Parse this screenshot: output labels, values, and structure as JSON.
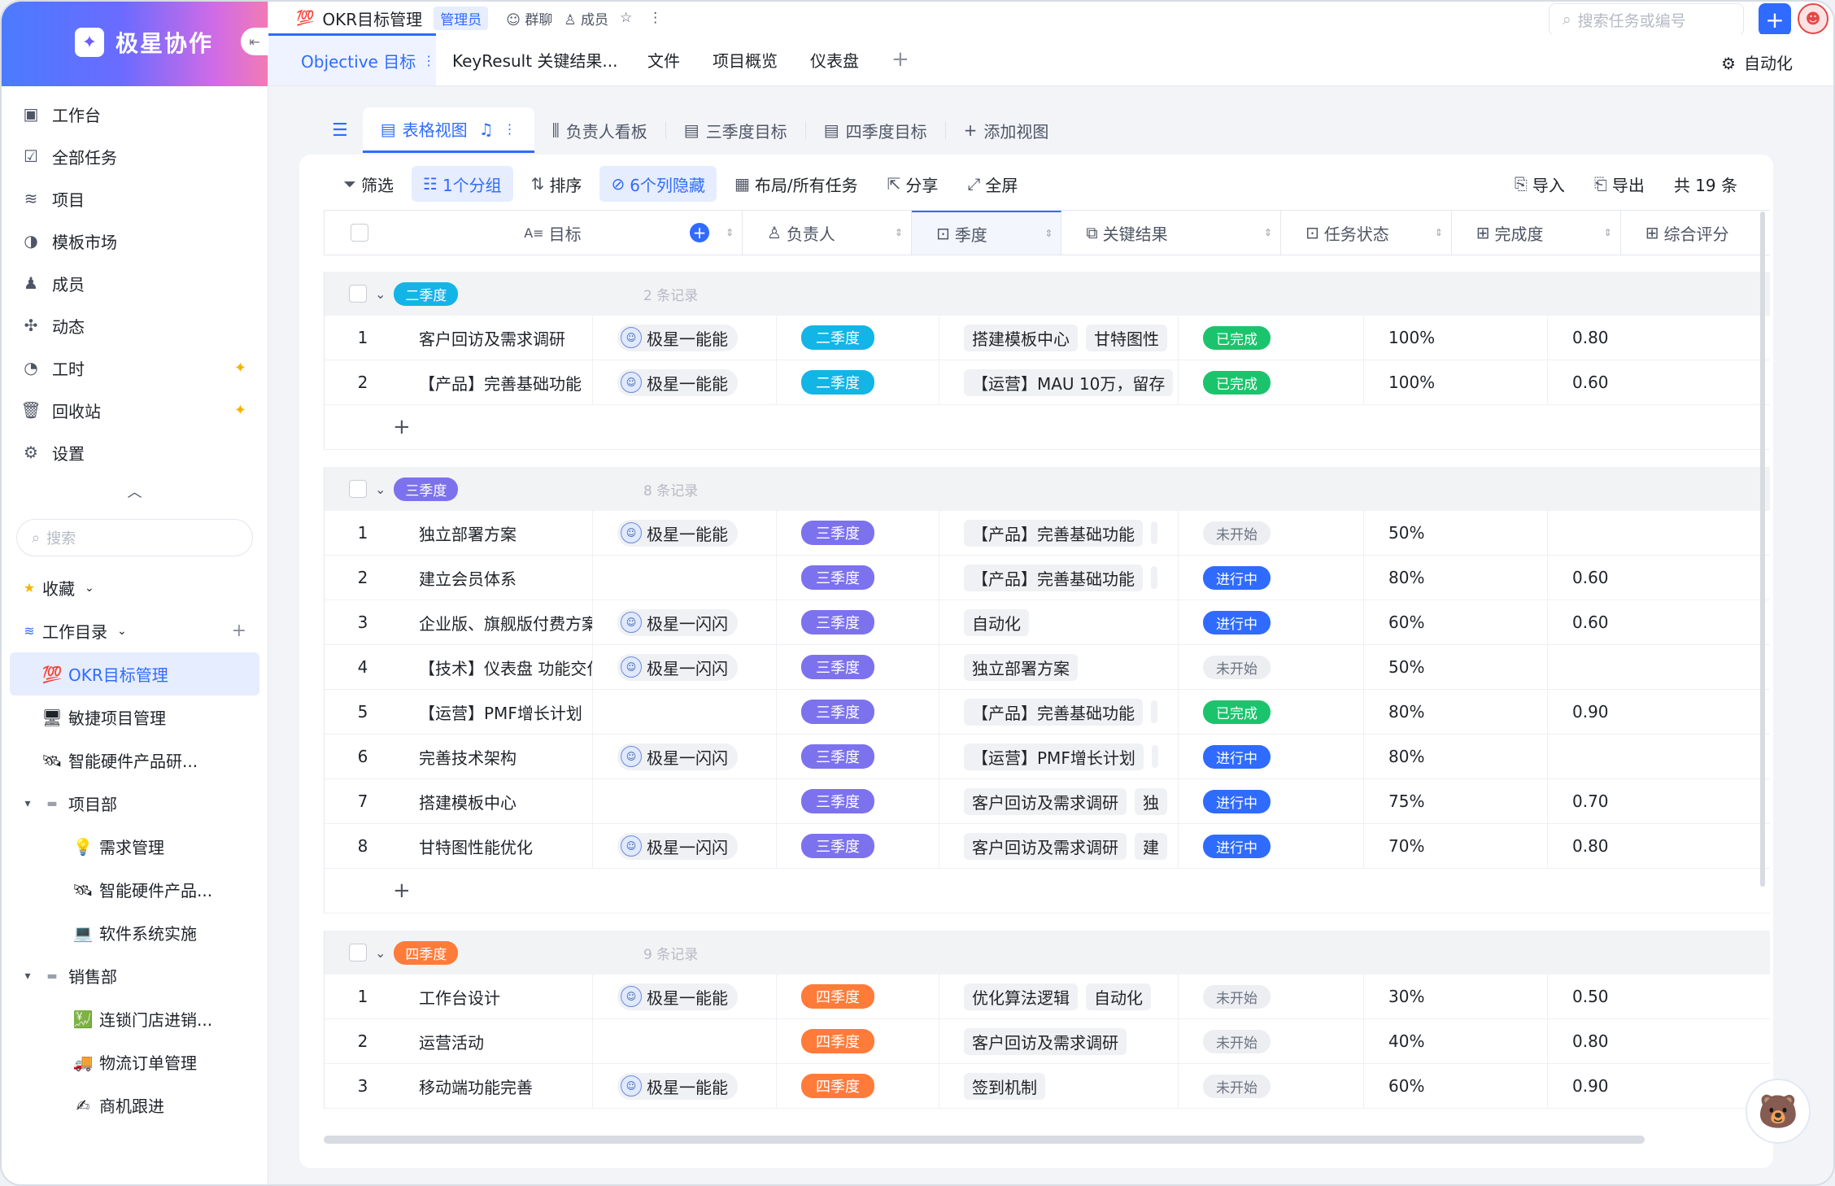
{
  "app": {
    "name": "极星协作"
  },
  "nav": [
    {
      "label": "工作台",
      "icon": "workbench-icon"
    },
    {
      "label": "全部任务",
      "icon": "tasks-icon"
    },
    {
      "label": "项目",
      "icon": "project-icon"
    },
    {
      "label": "模板市场",
      "icon": "template-icon"
    },
    {
      "label": "成员",
      "icon": "member-icon"
    },
    {
      "label": "动态",
      "icon": "activity-icon"
    },
    {
      "label": "工时",
      "icon": "clock-icon"
    },
    {
      "label": "回收站",
      "icon": "trash-icon"
    },
    {
      "label": "设置",
      "icon": "settings-icon"
    }
  ],
  "sidebar": {
    "search_placeholder": "搜索",
    "favorites": "收藏",
    "workdir": "工作目录",
    "tree": [
      {
        "label": "OKR目标管理",
        "emoji": "💯",
        "indent": 1,
        "active": true
      },
      {
        "label": "敏捷项目管理",
        "emoji": "🖥",
        "indent": 1
      },
      {
        "label": "智能硬件产品研...",
        "emoji": "🛰",
        "indent": 1
      },
      {
        "label": "项目部",
        "emoji": "▬",
        "indent": 0,
        "folder": true
      },
      {
        "label": "需求管理",
        "emoji": "💡",
        "indent": 2
      },
      {
        "label": "智能硬件产品...",
        "emoji": "🛰",
        "indent": 2
      },
      {
        "label": "软件系统实施",
        "emoji": "💻",
        "indent": 2
      },
      {
        "label": "销售部",
        "emoji": "▬",
        "indent": 0,
        "folder": true
      },
      {
        "label": "连锁门店进销...",
        "emoji": "💹",
        "indent": 2
      },
      {
        "label": "物流订单管理",
        "emoji": "🚚",
        "indent": 2
      },
      {
        "label": "商机跟进",
        "emoji": "✍",
        "indent": 2
      }
    ]
  },
  "topbar": {
    "title": "OKR目标管理",
    "title_emoji": "💯",
    "admin_badge": "管理员",
    "links": [
      "群聊",
      "成员"
    ],
    "search_placeholder": "搜索任务或编号"
  },
  "tabs": [
    "Objective 目标",
    "KeyResult 关键结果...",
    "文件",
    "项目概览",
    "仪表盘"
  ],
  "automation": "自动化",
  "views": [
    "表格视图",
    "负责人看板",
    "三季度目标",
    "四季度目标",
    "添加视图"
  ],
  "toolbar": {
    "filter": "筛选",
    "group": "1个分组",
    "sort": "排序",
    "hidden": "6个列隐藏",
    "layout": "布局/所有任务",
    "share": "分享",
    "fullscreen": "全屏",
    "import": "导入",
    "export": "导出",
    "total": "共 19 条"
  },
  "columns": [
    "目标",
    "负责人",
    "季度",
    "关键结果",
    "任务状态",
    "完成度",
    "综合评分"
  ],
  "colors": {
    "primary": "#2f6bff",
    "q2": "#13b5e6",
    "q3": "#7d72ee",
    "q4": "#ff7b3a",
    "done": "#1bc46c",
    "doing": "#2f6bff",
    "todo": "#eceef1"
  },
  "groups": [
    {
      "tag": "二季度",
      "count": "2 条记录",
      "rows": [
        {
          "n": "1",
          "goal": "客户回访及需求调研",
          "owner": "极星一能能",
          "q": "二季度",
          "krs": [
            "搭建模板中心",
            "甘特图性"
          ],
          "status": "已完成",
          "pct": "100%",
          "score": "0.80"
        },
        {
          "n": "2",
          "goal": "【产品】完善基础功能",
          "owner": "极星一能能",
          "q": "二季度",
          "krs": [
            "【运营】MAU 10万，留存"
          ],
          "status": "已完成",
          "pct": "100%",
          "score": "0.60"
        }
      ]
    },
    {
      "tag": "三季度",
      "count": "8 条记录",
      "rows": [
        {
          "n": "1",
          "goal": "独立部署方案",
          "owner": "极星一能能",
          "q": "三季度",
          "krs": [
            "【产品】完善基础功能",
            ""
          ],
          "status": "未开始",
          "pct": "50%",
          "score": ""
        },
        {
          "n": "2",
          "goal": "建立会员体系",
          "owner": "",
          "q": "三季度",
          "krs": [
            "【产品】完善基础功能",
            ""
          ],
          "status": "进行中",
          "pct": "80%",
          "score": "0.60"
        },
        {
          "n": "3",
          "goal": "企业版、旗舰版付费方案",
          "owner": "极星一闪闪",
          "q": "三季度",
          "krs": [
            "自动化"
          ],
          "status": "进行中",
          "pct": "60%",
          "score": "0.60"
        },
        {
          "n": "4",
          "goal": "【技术】仪表盘 功能交付",
          "owner": "极星一闪闪",
          "q": "三季度",
          "krs": [
            "独立部署方案"
          ],
          "status": "未开始",
          "pct": "50%",
          "score": ""
        },
        {
          "n": "5",
          "goal": "【运营】PMF增长计划",
          "owner": "",
          "q": "三季度",
          "krs": [
            "【产品】完善基础功能",
            ""
          ],
          "status": "已完成",
          "pct": "80%",
          "score": "0.90"
        },
        {
          "n": "6",
          "goal": "完善技术架构",
          "owner": "极星一闪闪",
          "q": "三季度",
          "krs": [
            "【运营】PMF增长计划",
            ""
          ],
          "status": "进行中",
          "pct": "80%",
          "score": ""
        },
        {
          "n": "7",
          "goal": "搭建模板中心",
          "owner": "",
          "q": "三季度",
          "krs": [
            "客户回访及需求调研",
            "独"
          ],
          "status": "进行中",
          "pct": "75%",
          "score": "0.70"
        },
        {
          "n": "8",
          "goal": "甘特图性能优化",
          "owner": "极星一闪闪",
          "q": "三季度",
          "krs": [
            "客户回访及需求调研",
            "建"
          ],
          "status": "进行中",
          "pct": "70%",
          "score": "0.80"
        }
      ]
    },
    {
      "tag": "四季度",
      "count": "9 条记录",
      "rows": [
        {
          "n": "1",
          "goal": "工作台设计",
          "owner": "极星一能能",
          "q": "四季度",
          "krs": [
            "优化算法逻辑",
            "自动化"
          ],
          "status": "未开始",
          "pct": "30%",
          "score": "0.50"
        },
        {
          "n": "2",
          "goal": "运营活动",
          "owner": "",
          "q": "四季度",
          "krs": [
            "客户回访及需求调研"
          ],
          "status": "未开始",
          "pct": "40%",
          "score": "0.80"
        },
        {
          "n": "3",
          "goal": "移动端功能完善",
          "owner": "极星一能能",
          "q": "四季度",
          "krs": [
            "签到机制"
          ],
          "status": "未开始",
          "pct": "60%",
          "score": "0.90"
        }
      ]
    }
  ]
}
